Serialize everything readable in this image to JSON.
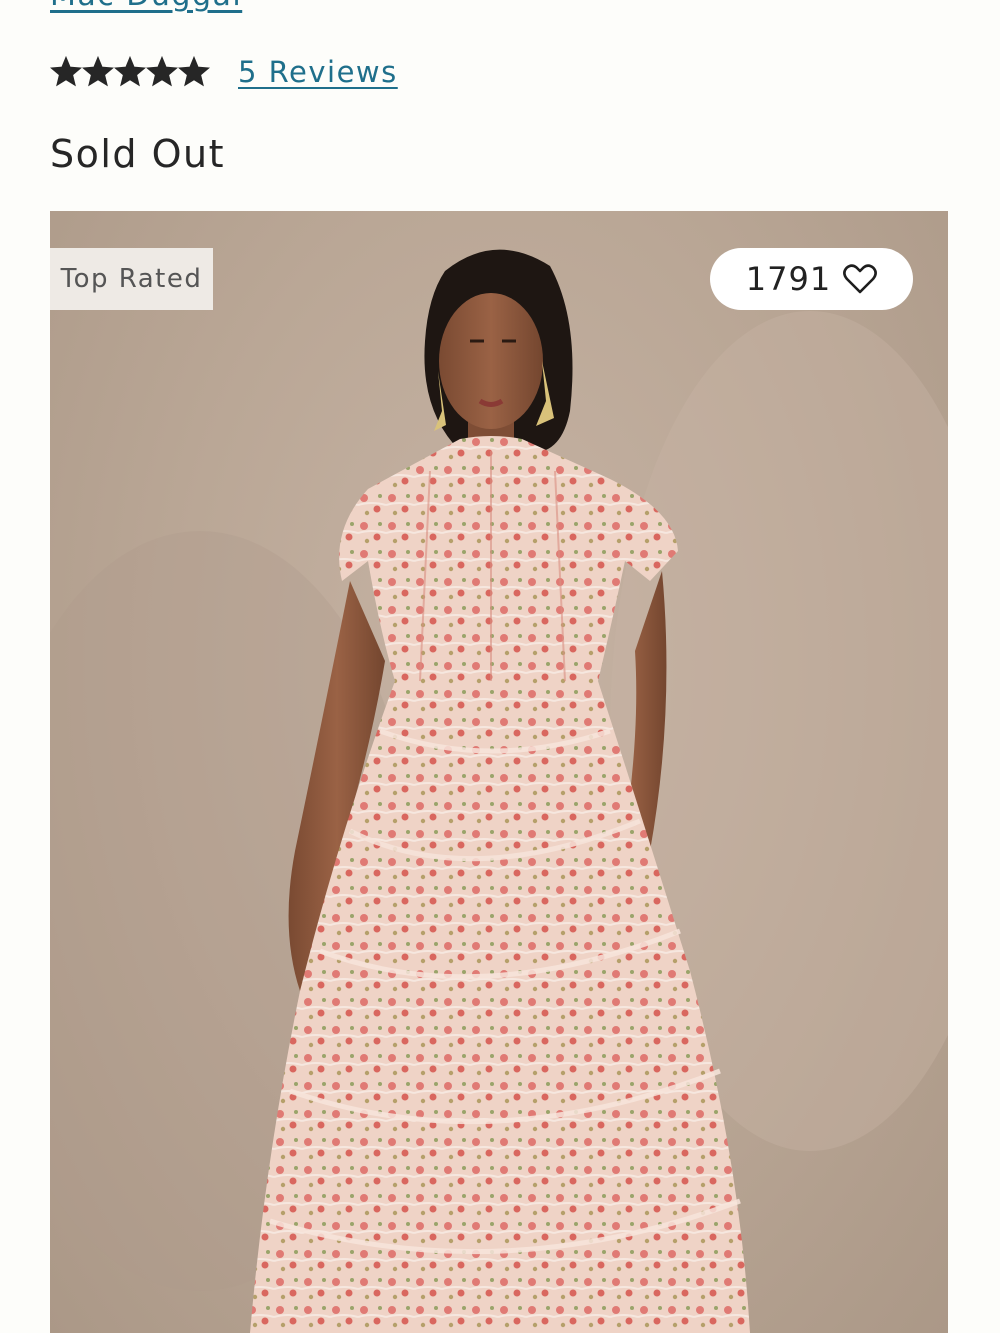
{
  "product": {
    "brand": "Mac Duggal",
    "rating": 5,
    "rating_max": 5,
    "reviews_label": "5 Reviews",
    "availability": "Sold Out"
  },
  "image": {
    "badge": "Top Rated",
    "favorite_count": "1791",
    "favorite_icon": "heart-outline-icon",
    "description_icon": "star-icon"
  },
  "colors": {
    "link": "#1f6f8b",
    "text": "#262626",
    "star": "#262626",
    "backdrop": "#bba898",
    "dress": "#e8bfb0"
  }
}
